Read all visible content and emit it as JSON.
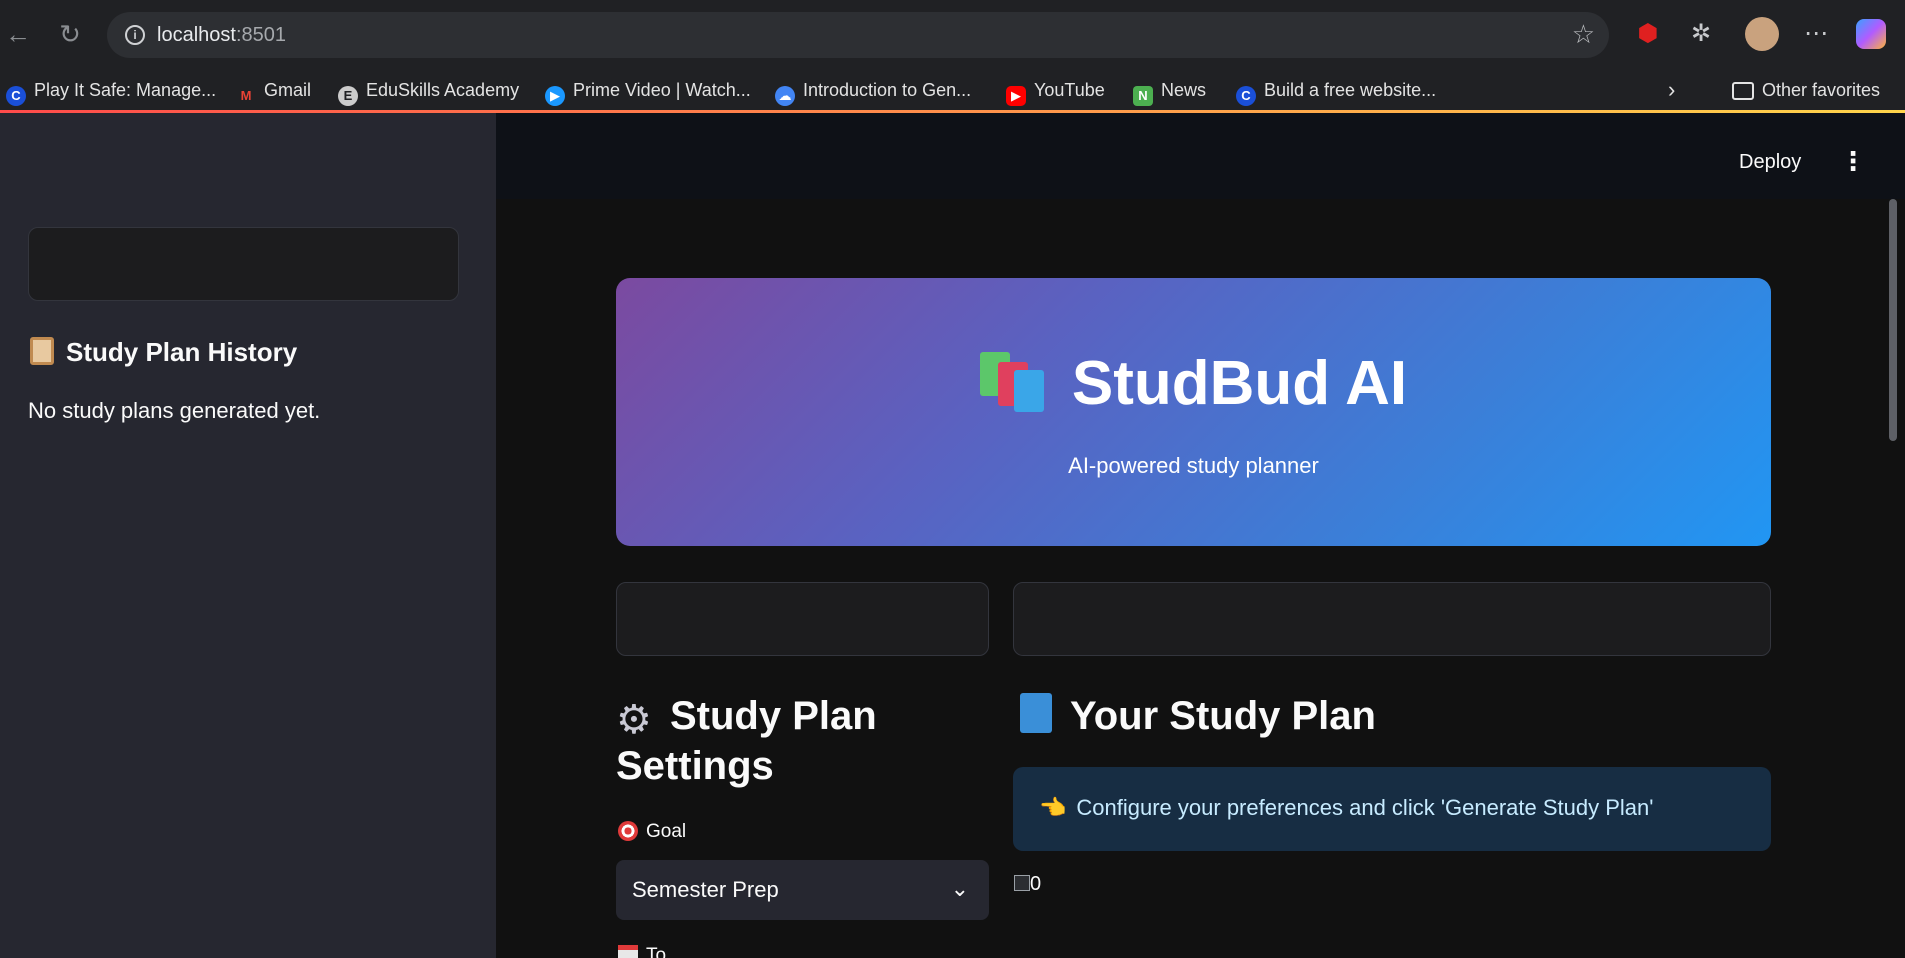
{
  "browser": {
    "url_host": "localhost",
    "url_port": ":8501",
    "bookmarks": [
      {
        "label": "Play It Safe: Manage...",
        "icon": "c-icon",
        "color": "#1a4fd8"
      },
      {
        "label": "Gmail",
        "icon": "gmail-icon",
        "color": "#ea4335"
      },
      {
        "label": "EduSkills Academy",
        "icon": "eduskills-icon",
        "color": "#cccccc"
      },
      {
        "label": "Prime Video | Watch...",
        "icon": "prime-video-icon",
        "color": "#1a98ff"
      },
      {
        "label": "Introduction to Gen...",
        "icon": "google-cloud-icon",
        "color": "#4285f4"
      },
      {
        "label": "YouTube",
        "icon": "youtube-icon",
        "color": "#ff0000"
      },
      {
        "label": "News",
        "icon": "news-icon",
        "color": "#4caf50"
      },
      {
        "label": "Build a free website...",
        "icon": "c-icon",
        "color": "#1a4fd8"
      }
    ],
    "other_favorites": "Other favorites"
  },
  "sidebar": {
    "title": "Study Plan History",
    "empty_text": "No study plans generated yet."
  },
  "header": {
    "deploy_label": "Deploy"
  },
  "hero": {
    "title": "StudBud AI",
    "subtitle": "AI-powered study planner",
    "gradient_start": "#7b4aa0",
    "gradient_end": "#2196f3"
  },
  "settings": {
    "heading": "Study Plan Settings",
    "goal_label": "Goal",
    "goal_value": "Semester Prep",
    "next_label": "To"
  },
  "plan": {
    "heading": "Your Study Plan",
    "info_text": "Configure your preferences and click 'Generate Study Plan'",
    "image_alt": "0"
  }
}
